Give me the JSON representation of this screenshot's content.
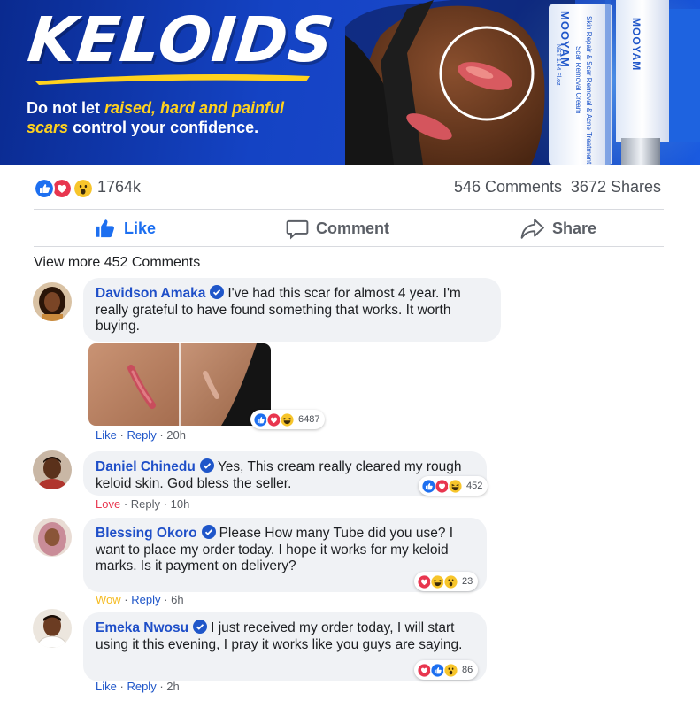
{
  "banner": {
    "headline": "KELOIDS",
    "tagline_parts": [
      {
        "text": "Do not let ",
        "highlight": false
      },
      {
        "text": "raised, hard and painful",
        "highlight": true
      },
      {
        "text": "scars",
        "highlight": true
      },
      {
        "text": " control your confidence.",
        "highlight": false
      }
    ],
    "product_brand": "MOOYAM",
    "product_label_1": "Scar Removal Cream",
    "product_label_2": "Skin Repair & Scar Removal & Acne Treatment & Pore",
    "product_net": "NET 1.64 Fl.oz",
    "colors": {
      "background": "#1443c4",
      "highlight": "#ffd21e",
      "text": "#ffffff"
    }
  },
  "post_stats": {
    "reactions": [
      "like",
      "love",
      "wow"
    ],
    "reaction_count": "1764k",
    "comments": "546 Comments",
    "shares": "3672 Shares"
  },
  "actions": {
    "like": "Like",
    "comment": "Comment",
    "share": "Share"
  },
  "view_more": "View more  452 Comments",
  "comments": [
    {
      "name": "Davidson Amaka",
      "verified": true,
      "text": "I've had this scar for almost 4 year. I'm really grateful to have found something that works. It worth buying.",
      "has_photo": true,
      "reactions": [
        "like",
        "love",
        "haha"
      ],
      "reaction_count": "6487",
      "my_reaction": "Like",
      "reply": "Reply",
      "time": "20h"
    },
    {
      "name": "Daniel Chinedu",
      "verified": true,
      "text": "Yes, This cream really cleared my rough keloid skin. God bless the seller.",
      "reactions": [
        "like",
        "love",
        "haha"
      ],
      "reaction_count": "452",
      "my_reaction": "Love",
      "reply": "Reply",
      "time": "10h"
    },
    {
      "name": "Blessing Okoro",
      "verified": true,
      "text": "Please How many Tube did you use? I want to place my order today. I hope it works for my keloid marks. Is it payment on delivery?",
      "reactions": [
        "love",
        "haha",
        "wow"
      ],
      "reaction_count": "23",
      "my_reaction": "Wow",
      "reply": "Reply",
      "time": "6h"
    },
    {
      "name": "Emeka Nwosu",
      "verified": true,
      "text": "I just received my order today, I will start using it this evening, I pray it works like you guys are saying.",
      "reactions": [
        "love",
        "like",
        "wow"
      ],
      "reaction_count": "86",
      "my_reaction": "Like",
      "reply": "Reply",
      "time": "2h"
    }
  ],
  "colors": {
    "like_blue": "#1d6ff0",
    "name_blue": "#1f4fc8",
    "love_red": "#e8364f",
    "wow_yellow": "#f5bb20",
    "bubble_grey": "#f0f2f5"
  }
}
